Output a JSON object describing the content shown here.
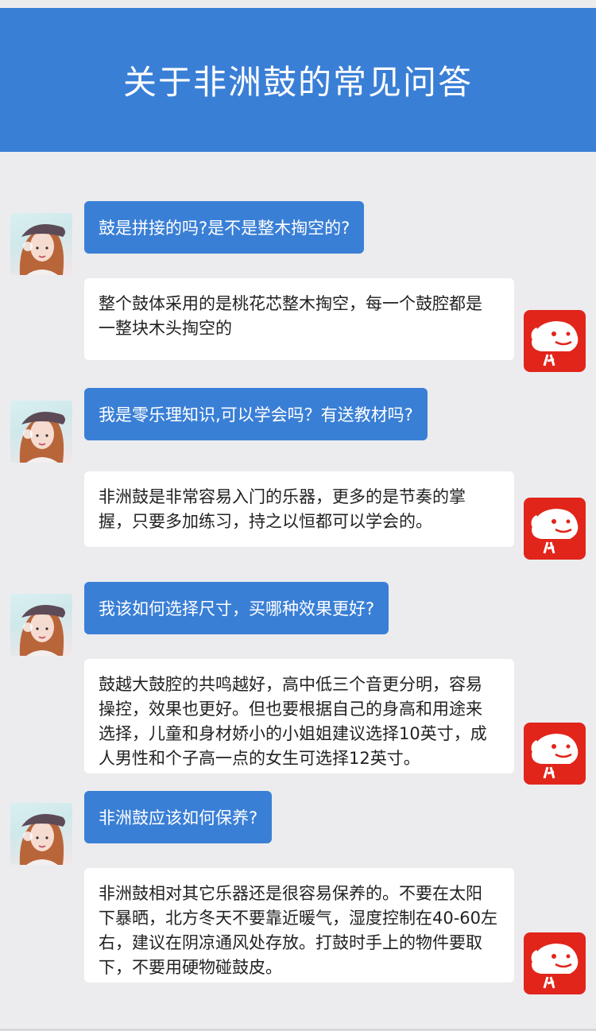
{
  "header": {
    "title": "关于非洲鼓的常见问答"
  },
  "colors": {
    "accent": "#3a7fd6",
    "background": "#ececef",
    "jd_red": "#e1251b"
  },
  "icons": {
    "user_avatar": "user-avatar-icon",
    "service_avatar": "jd-dog-icon"
  },
  "qa": [
    {
      "question": "鼓是拼接的吗?是不是整木掏空的?",
      "answer": "整个鼓体采用的是桃花芯整木掏空，每一个鼓腔都是一整块木头掏空的"
    },
    {
      "question": "我是零乐理知识,可以学会吗？有送教材吗?",
      "answer": "非洲鼓是非常容易入门的乐器，更多的是节奏的掌握，只要多加练习，持之以恒都可以学会的。"
    },
    {
      "question": "我该如何选择尺寸，买哪种效果更好?",
      "answer": "鼓越大鼓腔的共鸣越好，高中低三个音更分明，容易操控，效果也更好。但也要根据自己的身高和用途来选择，儿童和身材娇小的小姐姐建议选择10英寸，成人男性和个子高一点的女生可选择12英寸。"
    },
    {
      "question": "非洲鼓应该如何保养?",
      "answer": "非洲鼓相对其它乐器还是很容易保养的。不要在太阳下暴晒，北方冬天不要靠近暖气，湿度控制在40-60左右，建议在阴凉通风处存放。打鼓时手上的物件要取下，不要用硬物碰鼓皮。"
    }
  ]
}
